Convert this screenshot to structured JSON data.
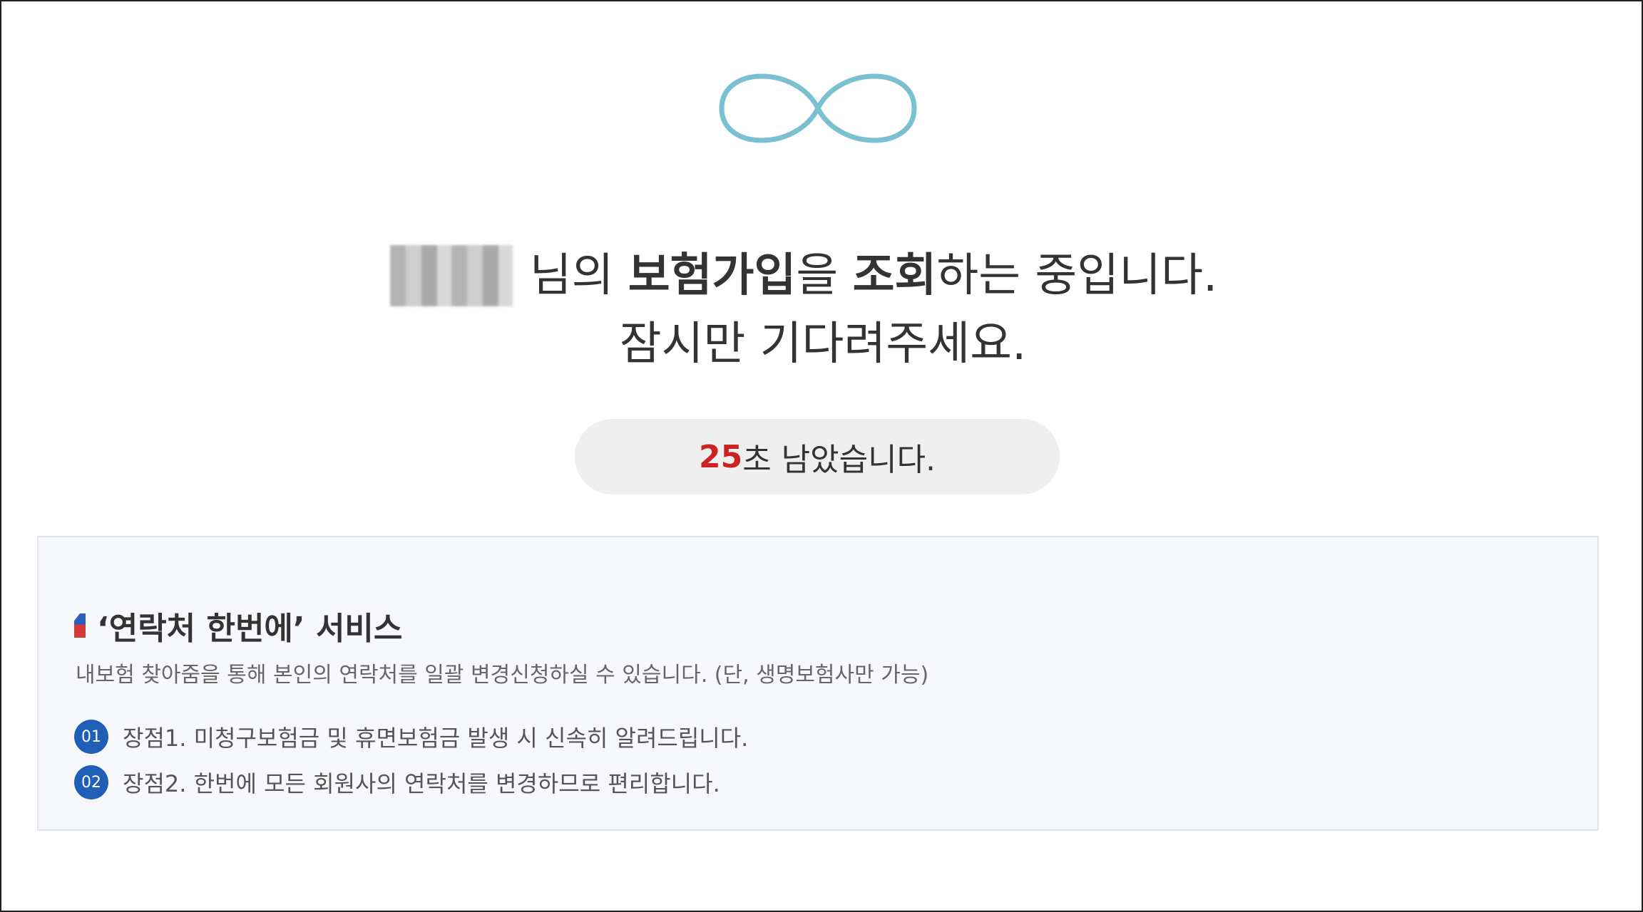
{
  "headline": {
    "name_suffix": "님의",
    "product": "보험가입",
    "particle": "을",
    "action": "조회",
    "ending": "하는 중입니다.",
    "line2": "잠시만 기다려주세요."
  },
  "timer": {
    "seconds": "25",
    "text": "초 남았습니다."
  },
  "info": {
    "title": "‘연락처 한번에’ 서비스",
    "description": "내보험 찾아줌을 통해 본인의 연락처를 일괄 변경신청하실 수 있습니다. (단, 생명보험사만 가능)",
    "benefits": [
      {
        "num": "01",
        "text": "장점1. 미청구보험금 및 휴면보험금 발생 시 신속히 알려드립니다."
      },
      {
        "num": "02",
        "text": "장점2. 한번에 모든 회원사의 연락처를 변경하므로 편리합니다."
      }
    ]
  },
  "colors": {
    "accent_red": "#cc2222",
    "badge_blue": "#1f5fb8",
    "loader": "#7bbfd2"
  },
  "icons": {
    "loader": "infinity-loader-icon",
    "title_mark": "flag-marker-icon"
  }
}
